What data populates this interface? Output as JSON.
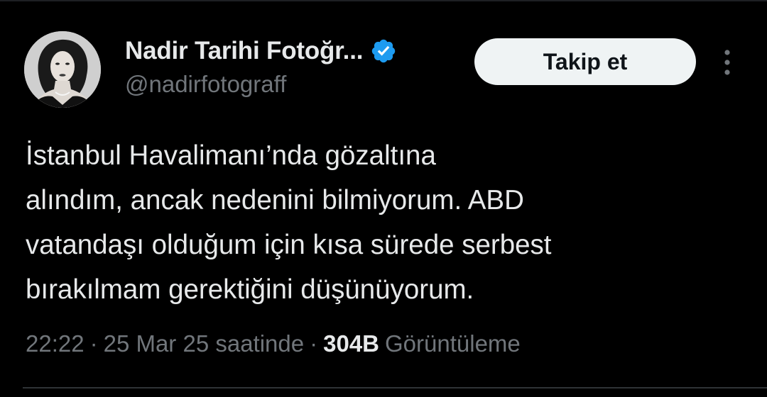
{
  "author": {
    "display_name": "Nadir Tarihi Fotoğr...",
    "handle": "@nadirfotograff",
    "verified": true,
    "avatar_icon": "portrait-avatar"
  },
  "actions": {
    "follow_label": "Takip et",
    "more_icon": "vertical-dots-icon"
  },
  "tweet": {
    "text": "İstanbul Havalimanı’nda gözaltına\nalındım, ancak nedenini bilmiyorum. ABD\nvatandaşı olduğum için kısa sürede serbest\nbırakılmam gerektiğini düşünüyorum."
  },
  "meta": {
    "time": "22:22",
    "separator": "·",
    "date": "25 Mar 25 saatinde",
    "views_count": "304B",
    "views_label": "Görüntüleme"
  },
  "colors": {
    "background": "#000000",
    "text_primary": "#e7e9ea",
    "text_secondary": "#71767b",
    "verified_blue": "#1d9bf0",
    "button_bg": "#eff3f4"
  }
}
